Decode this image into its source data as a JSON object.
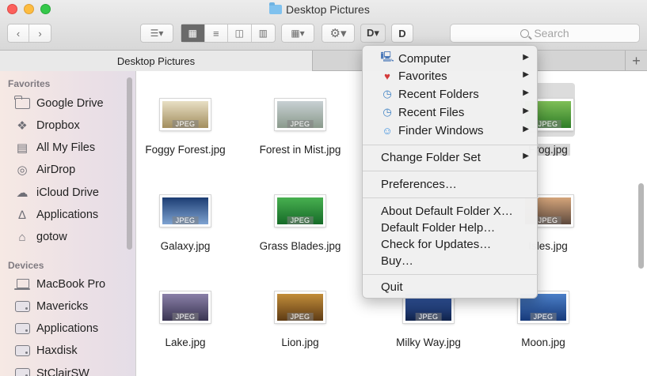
{
  "window": {
    "title": "Desktop Pictures",
    "tab_label": "Desktop Pictures",
    "tab_add": "+"
  },
  "toolbar": {
    "search_placeholder": "Search"
  },
  "sidebar": {
    "sections": [
      {
        "heading": "Favorites",
        "items": [
          {
            "label": "Google Drive",
            "icon": "folder-icon"
          },
          {
            "label": "Dropbox",
            "icon": "dropbox-icon"
          },
          {
            "label": "All My Files",
            "icon": "all-files-icon"
          },
          {
            "label": "AirDrop",
            "icon": "airdrop-icon"
          },
          {
            "label": "iCloud Drive",
            "icon": "cloud-icon"
          },
          {
            "label": "Applications",
            "icon": "applications-icon"
          },
          {
            "label": "gotow",
            "icon": "home-icon"
          }
        ]
      },
      {
        "heading": "Devices",
        "items": [
          {
            "label": "MacBook Pro",
            "icon": "laptop-icon"
          },
          {
            "label": "Mavericks",
            "icon": "drive-icon"
          },
          {
            "label": "Applications",
            "icon": "drive-icon"
          },
          {
            "label": "Haxdisk",
            "icon": "drive-icon"
          },
          {
            "label": "StClairSW",
            "icon": "drive-icon"
          }
        ]
      }
    ]
  },
  "files": [
    {
      "name": "Foggy Forest.jpg",
      "tag": "JPEG",
      "colors": [
        "#e8dfc4",
        "#a38e5e"
      ]
    },
    {
      "name": "Forest in Mist.jpg",
      "tag": "JPEG",
      "colors": [
        "#c8d0d3",
        "#8a9a8c"
      ]
    },
    {
      "name": "Frog.jpg",
      "tag": "JPEG",
      "colors": [
        "#7fbf57",
        "#2f7d28"
      ]
    },
    {
      "name": "Galaxy.jpg",
      "tag": "JPEG",
      "colors": [
        "#1c3d73",
        "#7ea3d1"
      ]
    },
    {
      "name": "Grass Blades.jpg",
      "tag": "JPEG",
      "colors": [
        "#48b050",
        "#166b28"
      ]
    },
    {
      "name": "Isles.jpg",
      "tag": "JPEG",
      "colors": [
        "#d4a47a",
        "#5e4a3e"
      ]
    },
    {
      "name": "Lake.jpg",
      "tag": "JPEG",
      "colors": [
        "#8a80a8",
        "#3a3552"
      ]
    },
    {
      "name": "Lion.jpg",
      "tag": "JPEG",
      "colors": [
        "#c28d3a",
        "#5e3b14"
      ]
    },
    {
      "name": "Milky Way.jpg",
      "tag": "JPEG",
      "colors": [
        "#3a64b8",
        "#10224a"
      ]
    },
    {
      "name": "Moon.jpg",
      "tag": "JPEG",
      "colors": [
        "#4b7fc8",
        "#173a7a"
      ]
    }
  ],
  "menu": {
    "groups": [
      [
        {
          "label": "Computer",
          "icon": "computer-icon",
          "submenu": true
        },
        {
          "label": "Favorites",
          "icon": "heart-icon",
          "submenu": true
        },
        {
          "label": "Recent Folders",
          "icon": "recent-folders-icon",
          "submenu": true
        },
        {
          "label": "Recent Files",
          "icon": "recent-files-icon",
          "submenu": true
        },
        {
          "label": "Finder Windows",
          "icon": "finder-icon",
          "submenu": true
        }
      ],
      [
        {
          "label": "Change Folder Set",
          "submenu": true
        }
      ],
      [
        {
          "label": "Preferences…"
        }
      ],
      [
        {
          "label": "About Default Folder X…"
        },
        {
          "label": "Default Folder Help…"
        },
        {
          "label": "Check for Updates…"
        },
        {
          "label": "Buy…"
        }
      ],
      [
        {
          "label": "Quit"
        }
      ]
    ]
  }
}
